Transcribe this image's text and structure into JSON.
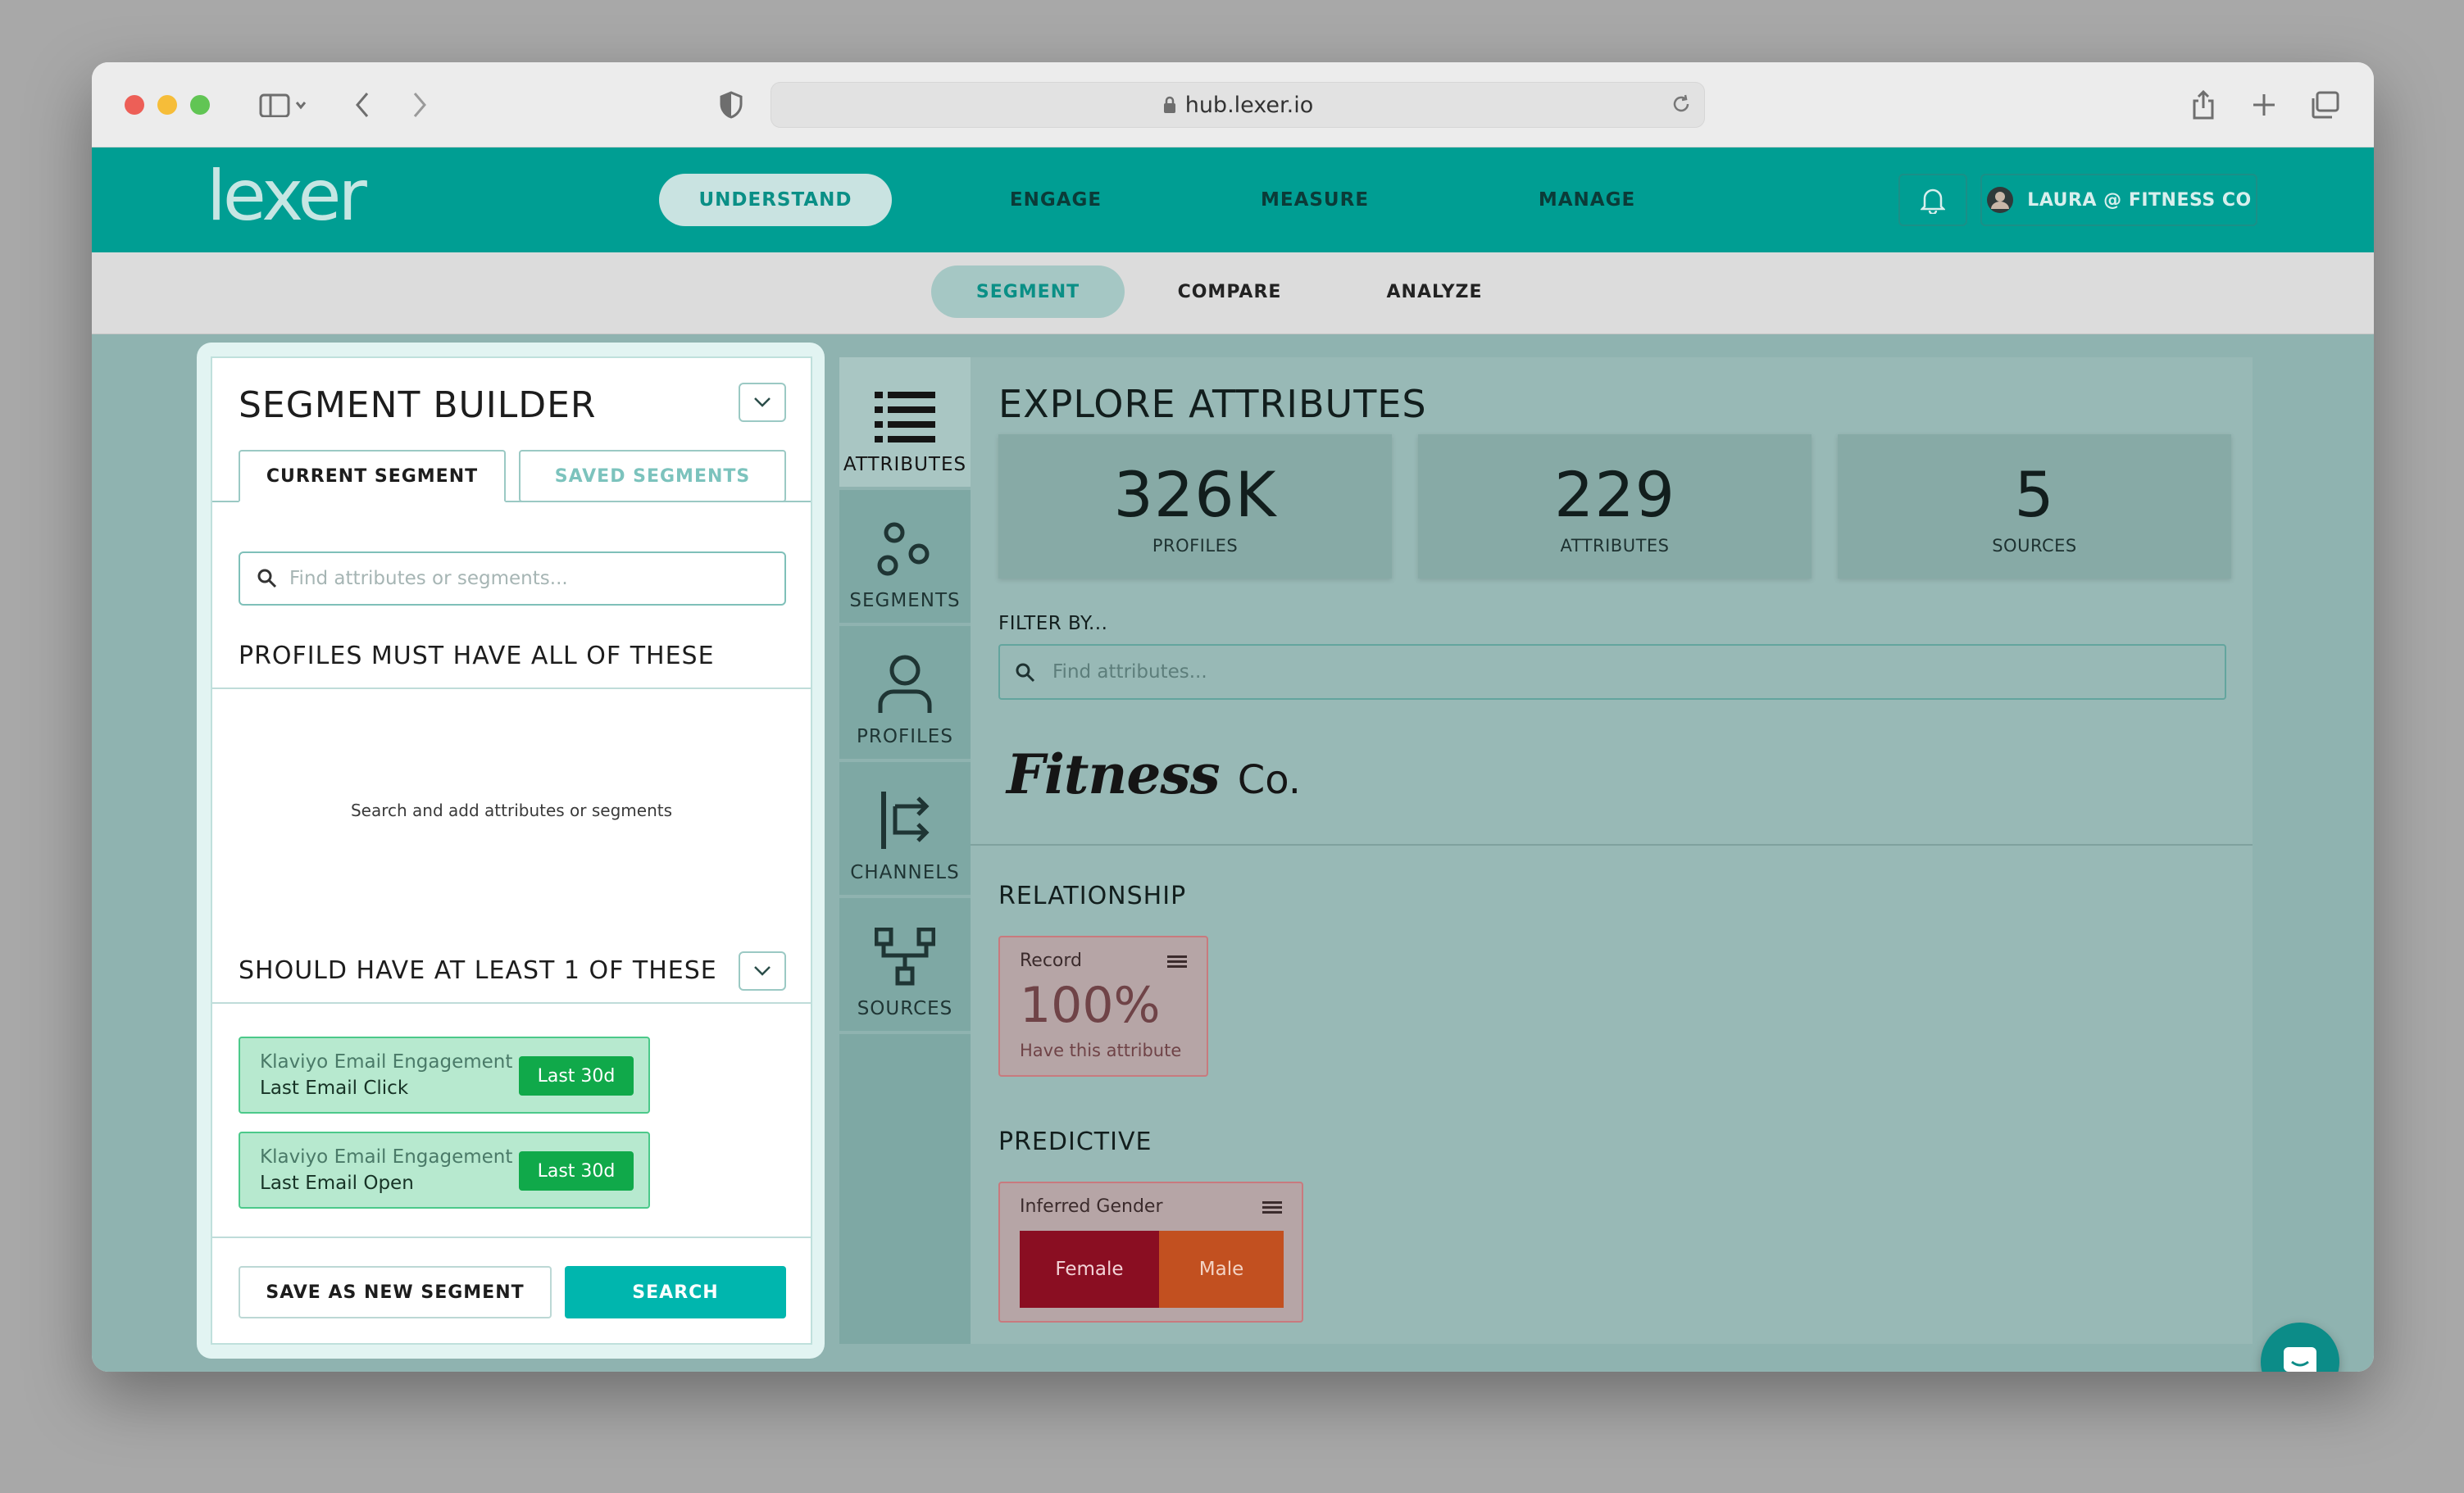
{
  "browser": {
    "url": "hub.lexer.io"
  },
  "brand": {
    "logo_text": "lexer"
  },
  "topnav": {
    "items": [
      {
        "label": "UNDERSTAND",
        "active": true
      },
      {
        "label": "ENGAGE",
        "active": false
      },
      {
        "label": "MEASURE",
        "active": false
      },
      {
        "label": "MANAGE",
        "active": false
      }
    ],
    "user_label": "LAURA @ FITNESS CO"
  },
  "subnav": {
    "items": [
      {
        "label": "SEGMENT",
        "active": true
      },
      {
        "label": "COMPARE",
        "active": false
      },
      {
        "label": "ANALYZE",
        "active": false
      }
    ]
  },
  "builder": {
    "title": "SEGMENT BUILDER",
    "tabs": [
      {
        "label": "CURRENT SEGMENT",
        "active": true
      },
      {
        "label": "SAVED SEGMENTS",
        "active": false
      }
    ],
    "search_placeholder": "Find attributes or segments...",
    "must_have_heading": "PROFILES MUST HAVE ALL OF THESE",
    "empty_message": "Search and add attributes or segments",
    "should_have_heading": "SHOULD HAVE AT LEAST 1 OF THESE",
    "attributes": [
      {
        "source": "Klaviyo Email Engagement",
        "name": "Last Email Click",
        "badge": "Last 30d"
      },
      {
        "source": "Klaviyo Email Engagement",
        "name": "Last Email Open",
        "badge": "Last 30d"
      }
    ],
    "save_label": "SAVE AS NEW SEGMENT",
    "search_label": "SEARCH"
  },
  "rail": {
    "items": [
      {
        "label": "ATTRIBUTES",
        "icon": "list-icon",
        "active": true
      },
      {
        "label": "SEGMENTS",
        "icon": "segments-icon",
        "active": false
      },
      {
        "label": "PROFILES",
        "icon": "person-icon",
        "active": false
      },
      {
        "label": "CHANNELS",
        "icon": "channels-icon",
        "active": false
      },
      {
        "label": "SOURCES",
        "icon": "sources-icon",
        "active": false
      }
    ]
  },
  "explore": {
    "title": "EXPLORE ATTRIBUTES",
    "stats": [
      {
        "value": "326K",
        "label": "PROFILES"
      },
      {
        "value": "229",
        "label": "ATTRIBUTES"
      },
      {
        "value": "5",
        "label": "SOURCES"
      }
    ],
    "filter_label": "FILTER BY...",
    "filter_placeholder": "Find attributes...",
    "brand_name": "Fitness",
    "brand_suffix": "Co.",
    "relationship_heading": "RELATIONSHIP",
    "record_card": {
      "label": "Record",
      "value": "100%",
      "subtitle": "Have this attribute"
    },
    "predictive_heading": "PREDICTIVE",
    "gender_card": {
      "label": "Inferred Gender",
      "female": "Female",
      "male": "Male"
    }
  },
  "colors": {
    "brand_teal": "#009e93",
    "accent": "#00b6ae",
    "badge_green": "#10a94a",
    "female": "#8a0e22",
    "male": "#c25020"
  }
}
